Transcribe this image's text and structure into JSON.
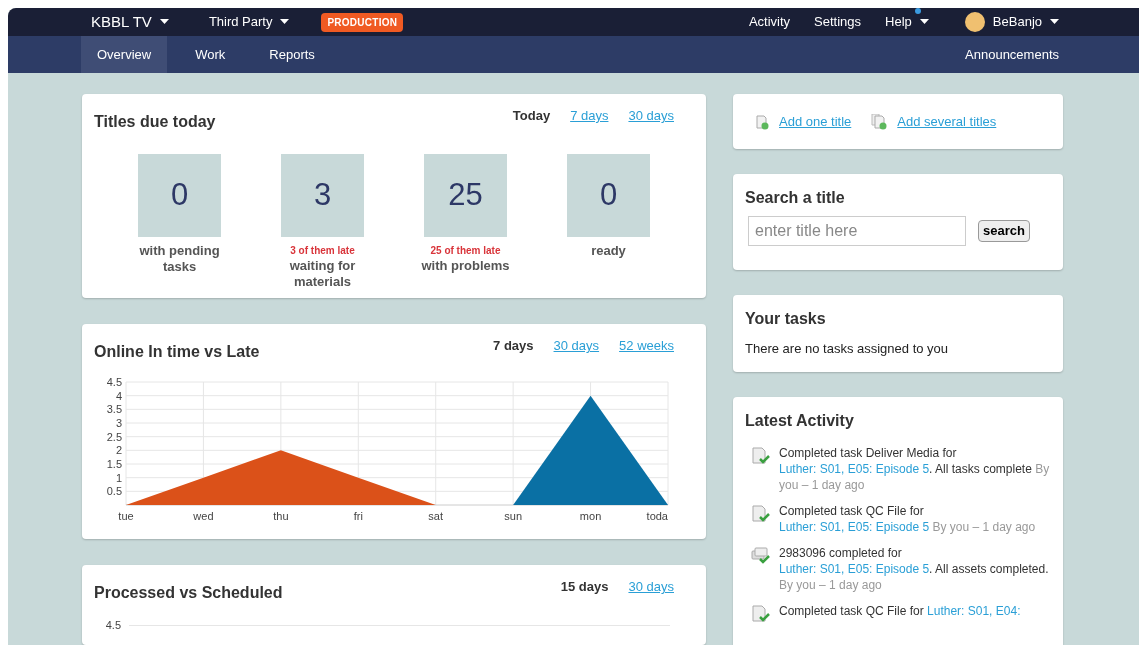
{
  "top_bar": {
    "account": {
      "label": "KBBL TV",
      "dropdown": true
    },
    "workspace": {
      "label": "Third Party",
      "dropdown": true
    },
    "environment_badge": "PRODUCTION",
    "menu": [
      {
        "label": "Activity",
        "dropdown": false,
        "notification": false
      },
      {
        "label": "Settings",
        "dropdown": false,
        "notification": false
      },
      {
        "label": "Help",
        "dropdown": true,
        "notification": true
      }
    ],
    "user": {
      "label": "BeBanjo",
      "dropdown": true
    }
  },
  "nav": {
    "tabs": [
      {
        "label": "Overview",
        "selected": true
      },
      {
        "label": "Work",
        "selected": false
      },
      {
        "label": "Reports",
        "selected": false
      }
    ],
    "right_link": "Announcements"
  },
  "titles_due": {
    "title": "Titles due today",
    "periods": [
      {
        "label": "Today",
        "selected": true
      },
      {
        "label": "7 days",
        "selected": false
      },
      {
        "label": "30 days",
        "selected": false
      }
    ],
    "stats": [
      {
        "value": "0",
        "label": "with pending tasks"
      },
      {
        "value": "3",
        "note": "3 of them late",
        "label": "waiting for materials"
      },
      {
        "value": "25",
        "note": "25 of them late",
        "label": "with problems"
      },
      {
        "value": "0",
        "label": "ready"
      }
    ]
  },
  "online_chart": {
    "title": "Online In time vs Late",
    "periods": [
      {
        "label": "7 days",
        "selected": true
      },
      {
        "label": "30 days",
        "selected": false
      },
      {
        "label": "52 weeks",
        "selected": false
      }
    ],
    "chart_data": {
      "type": "area",
      "grid": true,
      "categories": [
        "tue",
        "wed",
        "thu",
        "fri",
        "sat",
        "sun",
        "mon",
        "toda"
      ],
      "ylim": [
        0,
        4.5
      ],
      "yticks": [
        0.5,
        1,
        1.5,
        2,
        2.5,
        3,
        3.5,
        4,
        4.5
      ],
      "series": [
        {
          "color": "#db5119",
          "values": [
            0,
            1,
            2,
            1,
            0,
            null,
            null,
            null
          ]
        },
        {
          "color": "#0a70a4",
          "values": [
            null,
            null,
            null,
            null,
            null,
            0,
            4,
            0
          ]
        }
      ]
    }
  },
  "processed_chart": {
    "title": "Processed vs Scheduled",
    "periods": [
      {
        "label": "15 days",
        "selected": true
      },
      {
        "label": "30 days",
        "selected": false
      }
    ],
    "y_axis_label": "4.5"
  },
  "add_links": [
    "Add one title",
    "Add several titles"
  ],
  "search": {
    "title": "Search a title",
    "placeholder": "enter title here",
    "button": "search"
  },
  "tasks": {
    "title": "Your tasks",
    "message": "There are no tasks assigned to you"
  },
  "activity": {
    "title": "Latest Activity",
    "items": [
      {
        "kind": "task",
        "text": "Completed task Deliver Media for ",
        "link": "Luther: S01, E05: Episode 5",
        "after": ". All tasks complete",
        "meta": "By you – 1 day ago"
      },
      {
        "kind": "task",
        "text": "Completed task QC File for ",
        "link": "Luther: S01, E05: Episode 5",
        "meta": "By you – 1 day ago"
      },
      {
        "kind": "asset",
        "text": "2983096 completed for ",
        "link": "Luther: S01, E05: Episode 5",
        "after": ". All assets completed.",
        "meta": "By you – 1 day ago"
      },
      {
        "kind": "task",
        "text": "Completed task QC File for ",
        "link": "Luther: S01, E04:"
      }
    ]
  }
}
